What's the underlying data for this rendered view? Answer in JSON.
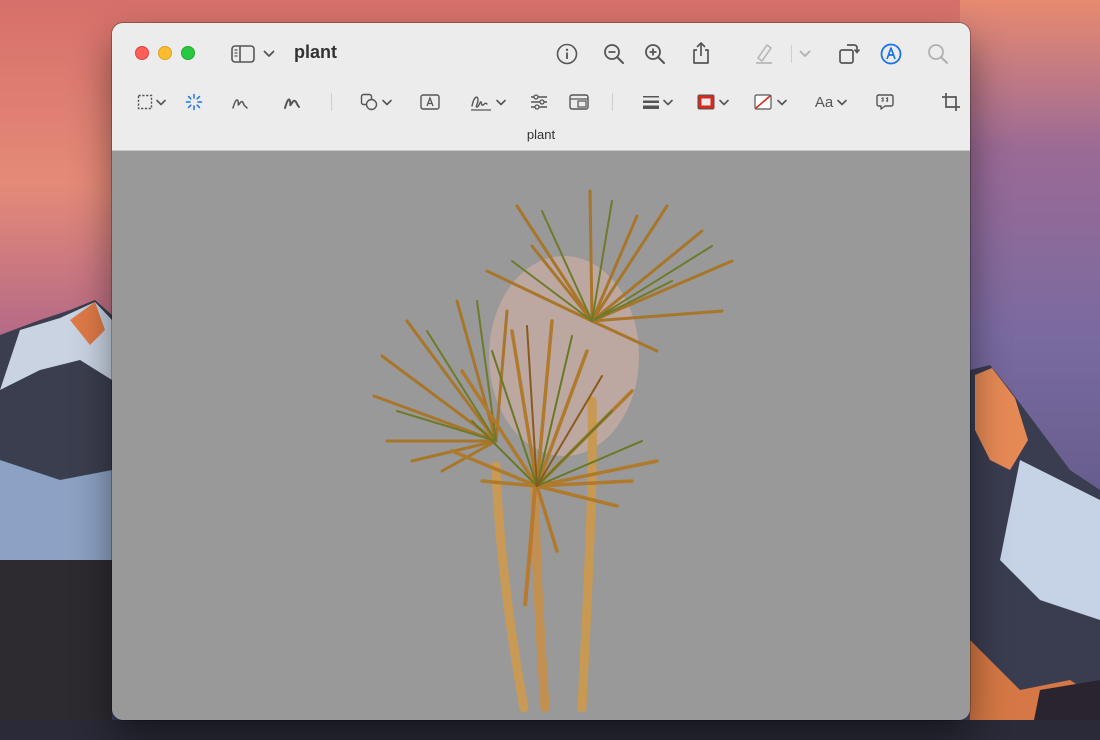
{
  "window": {
    "title": "plant",
    "subtitle": "plant"
  },
  "titlebar_icons": [
    "sidebar-toggle-icon",
    "chevron-down-icon",
    "info-icon",
    "zoom-out-icon",
    "zoom-in-icon",
    "share-icon",
    "highlight-pen-icon",
    "rotate-icon",
    "markup-icon",
    "search-icon"
  ],
  "markup_toolbar": [
    "rect-selection-icon",
    "instant-alpha-icon",
    "sketch-icon",
    "draw-icon",
    "shapes-icon",
    "text-box-icon",
    "signature-icon",
    "adjust-color-icon",
    "adjust-size-icon",
    "line-style-icon",
    "border-color-icon",
    "fill-color-icon",
    "text-style-icon",
    "annotate-icon",
    "crop-icon"
  ],
  "text_style_label": "Aa",
  "colors": {
    "accent": "#1a73e8",
    "border_color_swatch": "#d9281c",
    "canvas_bg": "#999999",
    "toolbar_bg": "#ececec"
  }
}
